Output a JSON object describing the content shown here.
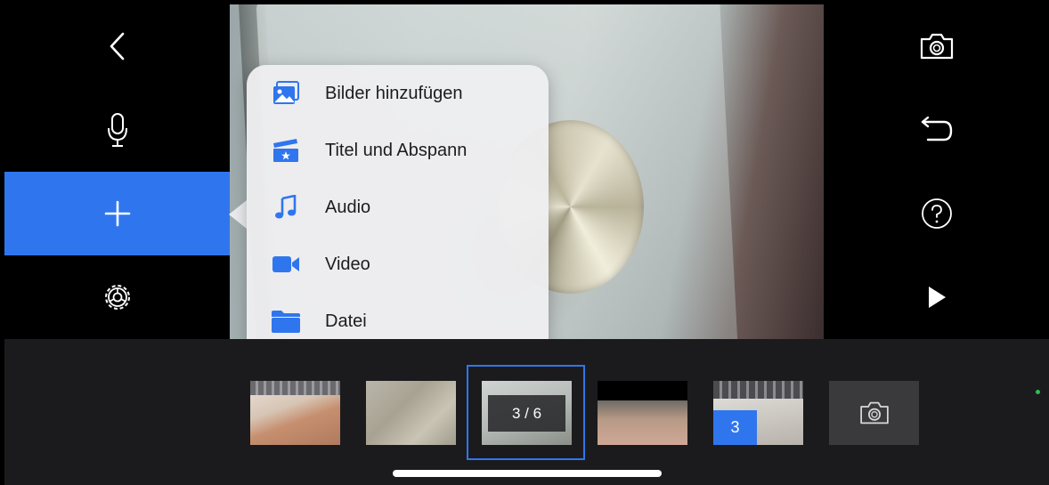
{
  "toolbar_left": {
    "items": [
      {
        "icon": "chevron-left-icon"
      },
      {
        "icon": "microphone-icon"
      },
      {
        "icon": "plus-icon",
        "selected": true
      },
      {
        "icon": "gear-icon"
      }
    ]
  },
  "toolbar_right": {
    "items": [
      {
        "icon": "camera-icon"
      },
      {
        "icon": "undo-icon"
      },
      {
        "icon": "help-icon"
      },
      {
        "icon": "play-icon"
      }
    ]
  },
  "add_menu": {
    "items": [
      {
        "label": "Bilder hinzufügen",
        "icon": "photos-icon"
      },
      {
        "label": "Titel und Abspann",
        "icon": "clapperboard-icon"
      },
      {
        "label": "Audio",
        "icon": "music-note-icon"
      },
      {
        "label": "Video",
        "icon": "video-camera-icon"
      },
      {
        "label": "Datei",
        "icon": "folder-icon"
      }
    ]
  },
  "timeline": {
    "selected_counter": "3 / 6",
    "clip_badge": "3",
    "add_clip_icon": "camera-icon"
  },
  "colors": {
    "accent": "#2f76ee",
    "menu_background": "#eeeef0",
    "toolbar_background": "#000000",
    "timeline_background": "#1b1b1d",
    "status_dot": "#2fbf4f"
  }
}
